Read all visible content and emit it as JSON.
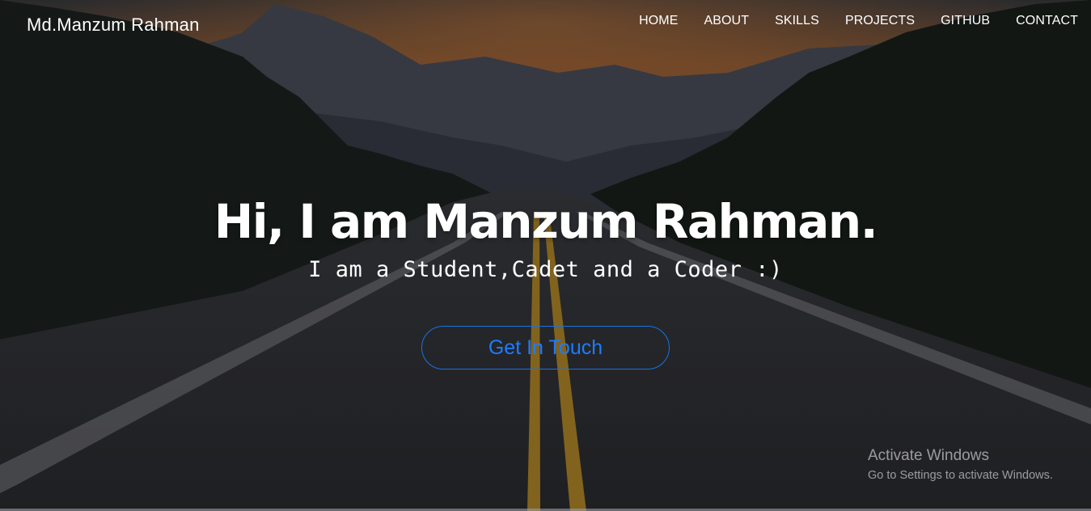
{
  "navbar": {
    "brand": "Md.Manzum Rahman",
    "links": [
      "HOME",
      "ABOUT",
      "SKILLS",
      "PROJECTS",
      "GITHUB",
      "CONTACT"
    ]
  },
  "hero": {
    "headline": "Hi, I am Manzum Rahman.",
    "subheadline": "I am a Student,Cadet and a Coder :)",
    "cta_label": "Get In Touch",
    "background": "mountain-road-sunset-image"
  },
  "os_overlay": {
    "title": "Activate Windows",
    "subtitle": "Go to Settings to activate Windows."
  },
  "colors": {
    "accent": "#1f7bff",
    "text": "#ffffff"
  }
}
